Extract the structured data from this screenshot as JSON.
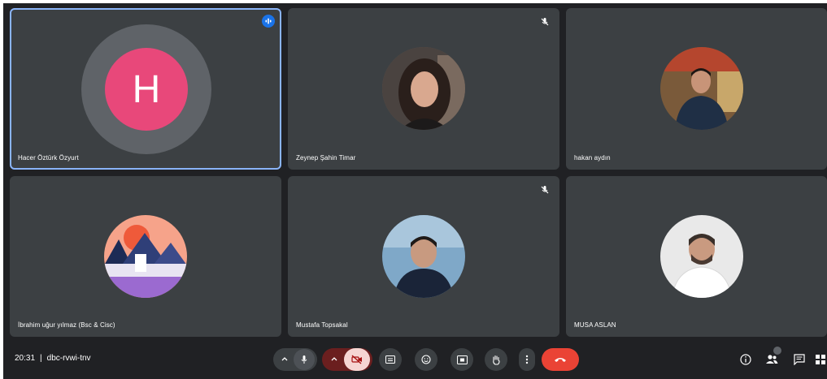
{
  "meeting": {
    "time": "20:31",
    "separator": "|",
    "code": "dbc-rvwi-tnv"
  },
  "participants": [
    {
      "name": "Hacer Öztürk Özyurt",
      "avatar_letter": "H",
      "avatar_color": "#e8487a",
      "speaking": true,
      "muted": false
    },
    {
      "name": "Zeynep Şahin Timar",
      "muted": true
    },
    {
      "name": "hakan aydın",
      "muted": false
    },
    {
      "name": "İbrahim uğur yılmaz (Bsc & Cisc)",
      "muted": false
    },
    {
      "name": "Mustafa Topsakal",
      "muted": true
    },
    {
      "name": "MUSA ASLAN",
      "muted": false
    }
  ],
  "controls": {
    "leave_color": "#ea4335",
    "active_color": "#8ab4f8"
  },
  "icons": [
    "chevron-up-icon",
    "microphone-icon",
    "camera-off-icon",
    "captions-icon",
    "emoji-icon",
    "present-icon",
    "raise-hand-icon",
    "more-options-icon",
    "hang-up-icon",
    "info-icon",
    "people-icon",
    "chat-icon",
    "activities-icon"
  ]
}
